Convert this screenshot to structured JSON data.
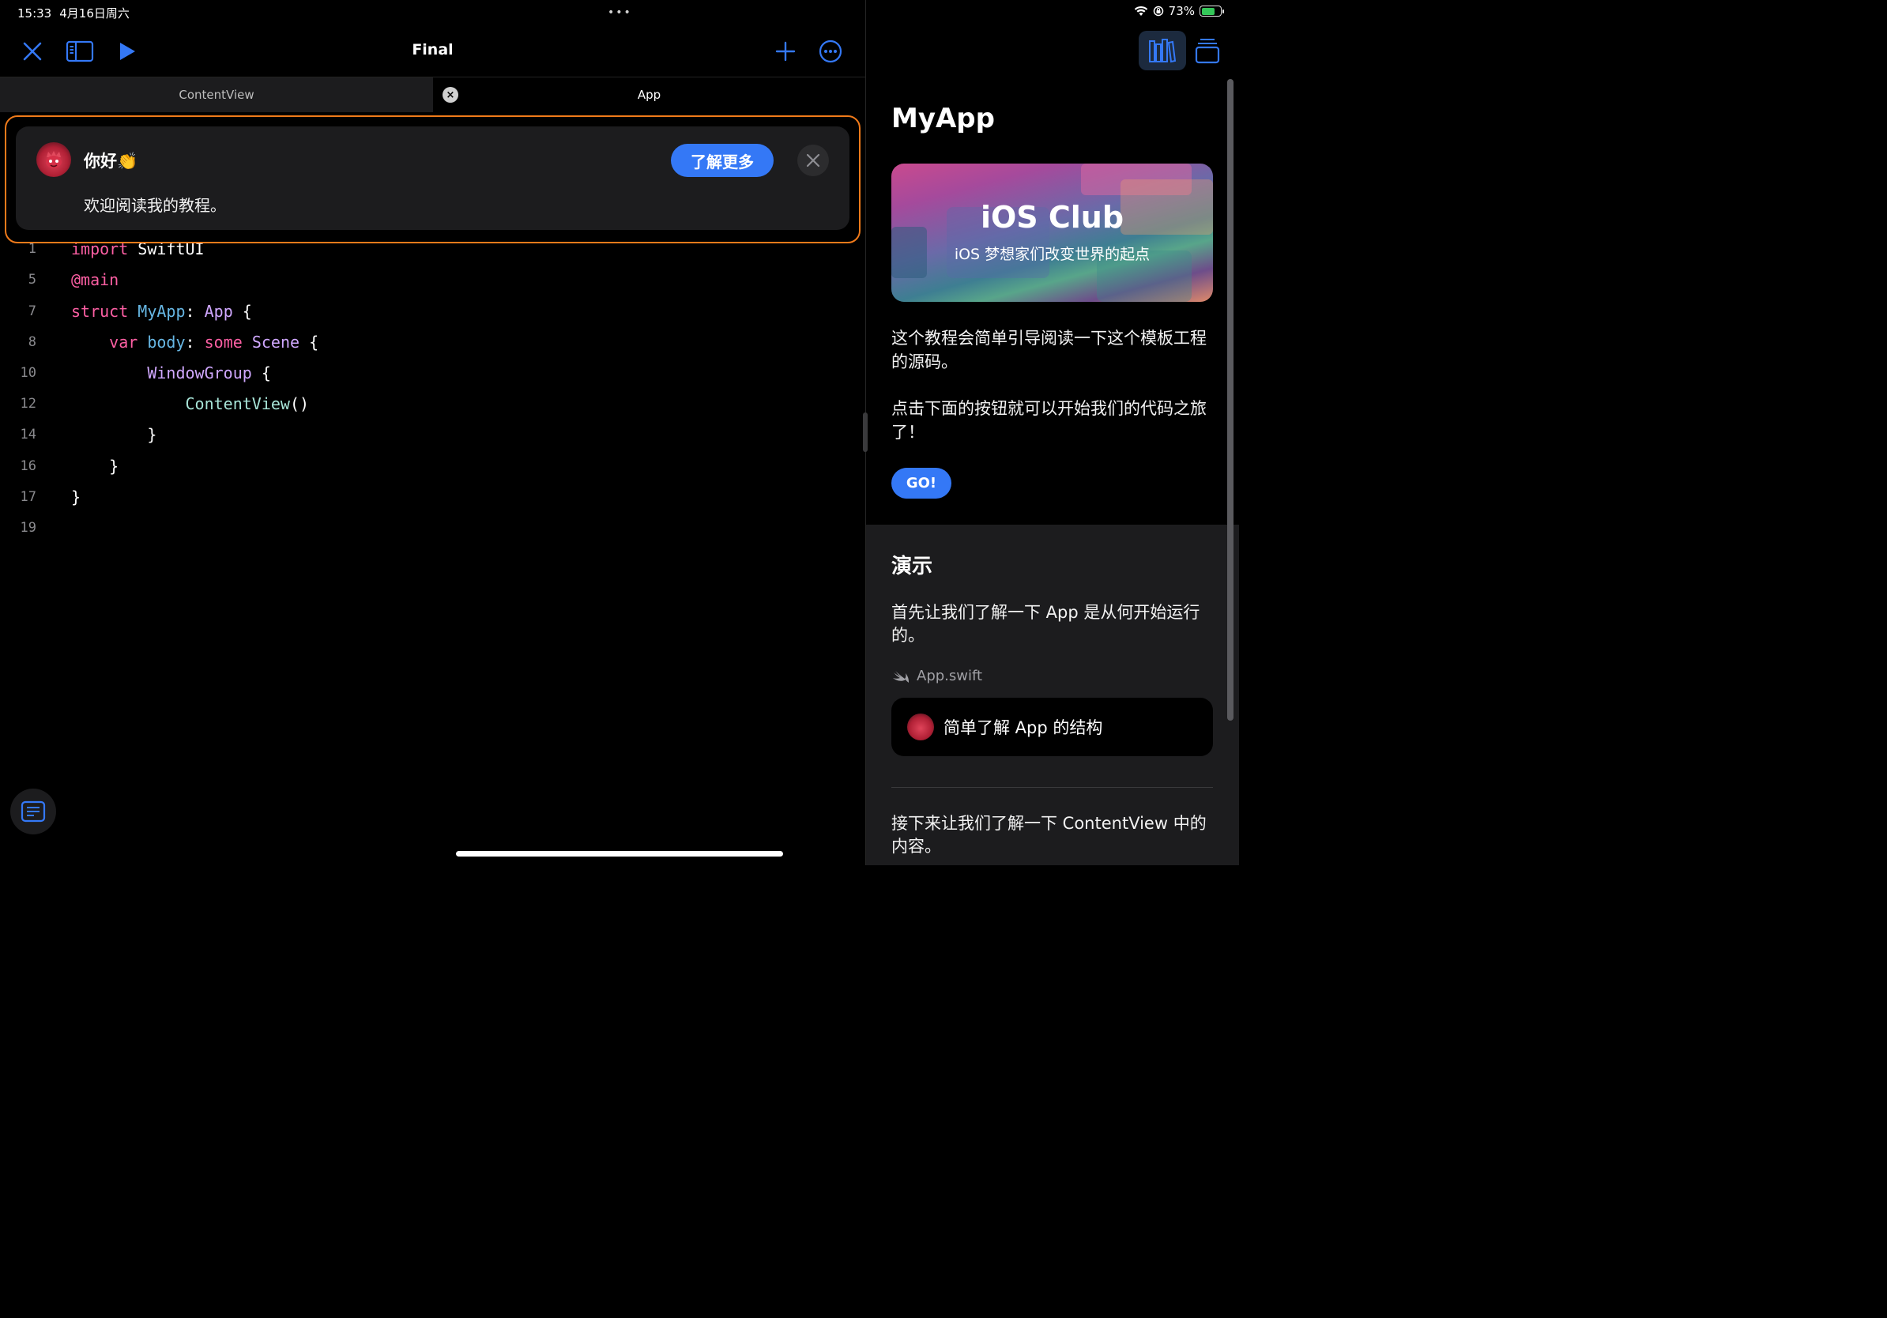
{
  "status_bar": {
    "time": "15:33",
    "date": "4月16日周六",
    "battery": "73%",
    "battery_level": 0.73,
    "more_dots": "•••"
  },
  "toolbar": {
    "title": "Final",
    "close_icon": "close-icon",
    "sidebar_icon": "sidebar-icon",
    "run_icon": "play-icon",
    "add_icon": "plus-icon",
    "more_icon": "ellipsis-circle-icon",
    "accent_color": "#3478f6"
  },
  "tabs": [
    {
      "label": "ContentView",
      "active": false
    },
    {
      "label": "App",
      "active": true
    }
  ],
  "banner": {
    "greeting": "你好👏",
    "message": "欢迎阅读我的教程。",
    "learn_more": "了解更多",
    "highlight_color": "#f07a1a"
  },
  "code": {
    "lines": [
      {
        "num": "1",
        "text": "import SwiftUI"
      },
      {
        "num": "5",
        "text": "@main"
      },
      {
        "num": "7",
        "text": "struct MyApp: App {"
      },
      {
        "num": "8",
        "text": "var body: some Scene {"
      },
      {
        "num": "10",
        "text": "WindowGroup {"
      },
      {
        "num": "12",
        "text": "ContentView()"
      },
      {
        "num": "14",
        "text": "}"
      },
      {
        "num": "16",
        "text": "}"
      },
      {
        "num": "17",
        "text": "}"
      },
      {
        "num": "19",
        "text": ""
      }
    ]
  },
  "right_panel": {
    "title": "MyApp",
    "hero_title": "iOS Club",
    "hero_subtitle": "iOS 梦想家们改变世界的起点",
    "intro_1": "这个教程会简单引导阅读一下这个模板工程的源码。",
    "intro_2": "点击下面的按钮就可以开始我们的代码之旅了！",
    "go_button": "GO!",
    "section_title": "演示",
    "section_text_1": "首先让我们了解一下 App 是从何开始运行的。",
    "file_name": "App.swift",
    "step_label": "简单了解 App 的结构",
    "section_text_2": "接下来让我们了解一下 ContentView 中的内容。"
  }
}
